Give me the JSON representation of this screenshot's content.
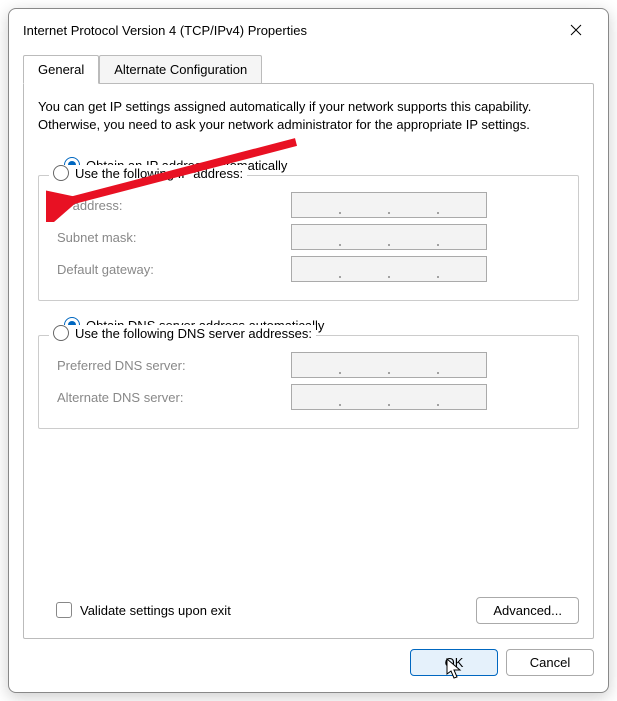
{
  "window": {
    "title": "Internet Protocol Version 4 (TCP/IPv4) Properties"
  },
  "tabs": [
    {
      "label": "General",
      "active": true
    },
    {
      "label": "Alternate Configuration",
      "active": false
    }
  ],
  "description": "You can get IP settings assigned automatically if your network supports this capability. Otherwise, you need to ask your network administrator for the appropriate IP settings.",
  "ip_section": {
    "auto_label": "Obtain an IP address automatically",
    "manual_label": "Use the following IP address:",
    "selected": "auto",
    "fields": {
      "ip_address_label": "IP address:",
      "subnet_mask_label": "Subnet mask:",
      "default_gateway_label": "Default gateway:",
      "ip_address": "",
      "subnet_mask": "",
      "default_gateway": ""
    }
  },
  "dns_section": {
    "auto_label": "Obtain DNS server address automatically",
    "manual_label": "Use the following DNS server addresses:",
    "selected": "auto",
    "fields": {
      "preferred_label": "Preferred DNS server:",
      "alternate_label": "Alternate DNS server:",
      "preferred": "",
      "alternate": ""
    }
  },
  "validate_checkbox": {
    "label": "Validate settings upon exit",
    "checked": false
  },
  "buttons": {
    "advanced": "Advanced...",
    "ok": "OK",
    "cancel": "Cancel"
  }
}
